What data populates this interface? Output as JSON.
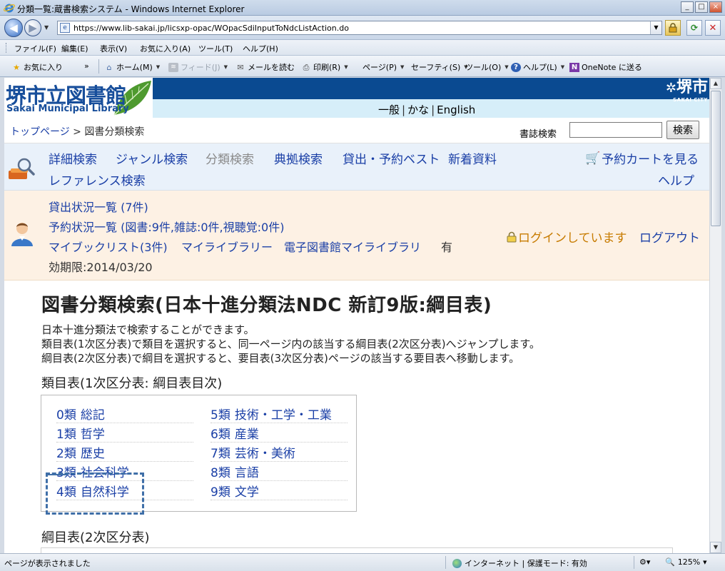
{
  "window": {
    "title": "分類一覧:蔵書検索システム - Windows Internet Explorer",
    "minimize": "_",
    "maximize": "□",
    "close": "×"
  },
  "address": {
    "url": "https://www.lib-sakai.jp/licsxp-opac/WOpacSdiInputToNdcListAction.do"
  },
  "menu": [
    "ファイル(F)",
    "編集(E)",
    "表示(V)",
    "お気に入り(A)",
    "ツール(T)",
    "ヘルプ(H)"
  ],
  "commands": {
    "favorites": "お気に入り",
    "home": "ホーム(M)",
    "feed": "フィード(J)",
    "read_mail": "メールを読む",
    "print": "印刷(R)",
    "page": "ページ(P)",
    "safety": "セーフティ(S)",
    "tools": "ツール(O)",
    "help": "ヘルプ(L)",
    "onenote": "OneNote に送る"
  },
  "header": {
    "logo_jp": "堺市立図書館",
    "logo_en": "Sakai Municipal Library",
    "city_kanji": "堺市",
    "city_en": "SAKAI CITY",
    "lang": [
      "一般",
      "かな",
      "English"
    ]
  },
  "breadcrumb": {
    "home": "トップページ",
    "sep": " > ",
    "current": "図書分類検索"
  },
  "search": {
    "label": "書誌検索",
    "placeholder": "",
    "button": "検索"
  },
  "nav": {
    "row1": [
      "詳細検索",
      "ジャンル検索",
      "分類検索",
      "典拠検索",
      "貸出・予約ベスト",
      "新着資料"
    ],
    "row2": [
      "レファレンス検索"
    ],
    "cart": "予約カートを見る",
    "help": "ヘルプ"
  },
  "user": {
    "loans": "貸出状況一覧 (7件)",
    "reservations": "予約状況一覧 (図書:9件,雑誌:0件,視聴覚:0件)",
    "booklist": "マイブックリスト(3件)",
    "mylibrary": "マイライブラリー",
    "ebook": "電子図書館マイライブラリ",
    "validity_prefix": "有",
    "validity": "効期限:2014/03/20",
    "login_status": "ログインしています",
    "logout": "ログアウト"
  },
  "content": {
    "title": "図書分類検索(日本十進分類法NDC 新訂9版:綱目表)",
    "desc": [
      "日本十進分類法で検索することができます。",
      "類目表(1次区分表)で類目を選択すると、同一ページ内の該当する綱目表(2次区分表)へジャンプします。",
      "綱目表(2次区分表)で綱目を選択すると、要目表(3次区分表)ページの該当する要目表へ移動します。"
    ],
    "section1": "類目表(1次区分表: 綱目表目次)",
    "section2": "綱目表(2次区分表)",
    "classes": [
      {
        "num": "0類",
        "name": "総記"
      },
      {
        "num": "1類",
        "name": "哲学"
      },
      {
        "num": "2類",
        "name": "歴史"
      },
      {
        "num": "3類",
        "name": "社会科学"
      },
      {
        "num": "4類",
        "name": "自然科学"
      },
      {
        "num": "5類",
        "name": "技術・工学・工業"
      },
      {
        "num": "6類",
        "name": "産業"
      },
      {
        "num": "7類",
        "name": "芸術・美術"
      },
      {
        "num": "8類",
        "name": "言語"
      },
      {
        "num": "9類",
        "name": "文学"
      }
    ]
  },
  "status": {
    "text": "ページが表示されました",
    "zone": "インターネット | 保護モード: 有効",
    "zoom": "125%"
  }
}
